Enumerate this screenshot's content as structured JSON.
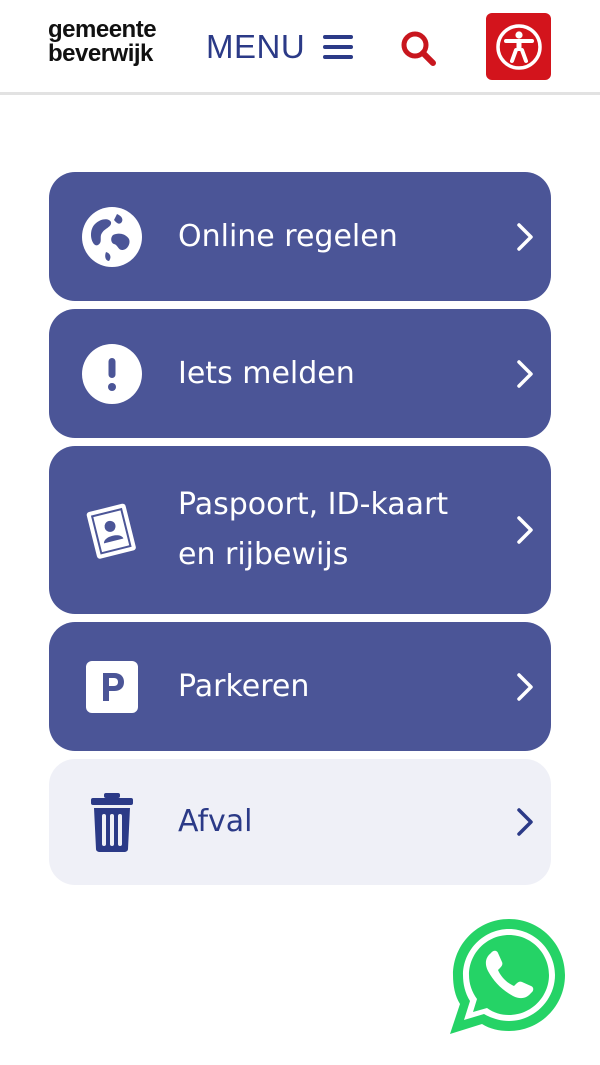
{
  "header": {
    "logo_line1": "gemeente",
    "logo_line2": "beverwijk",
    "menu_label": "MENU",
    "search_icon": "search-icon",
    "accessibility_icon": "accessibility-icon"
  },
  "colors": {
    "brand_blue": "#2b3a87",
    "tile_blue": "#4b5597",
    "tile_light": "#eff0f7",
    "accent_red": "#d3141c",
    "whatsapp_green": "#25d366"
  },
  "tiles": [
    {
      "label": "Online regelen",
      "icon": "globe-icon"
    },
    {
      "label": "Iets melden",
      "icon": "exclamation-icon"
    },
    {
      "label": "Paspoort, ID-kaart en rijbewijs",
      "icon": "passport-icon"
    },
    {
      "label": "Parkeren",
      "icon": "parking-icon"
    },
    {
      "label": "Afval",
      "icon": "trash-icon"
    }
  ],
  "floating": {
    "icon": "whatsapp-icon"
  }
}
